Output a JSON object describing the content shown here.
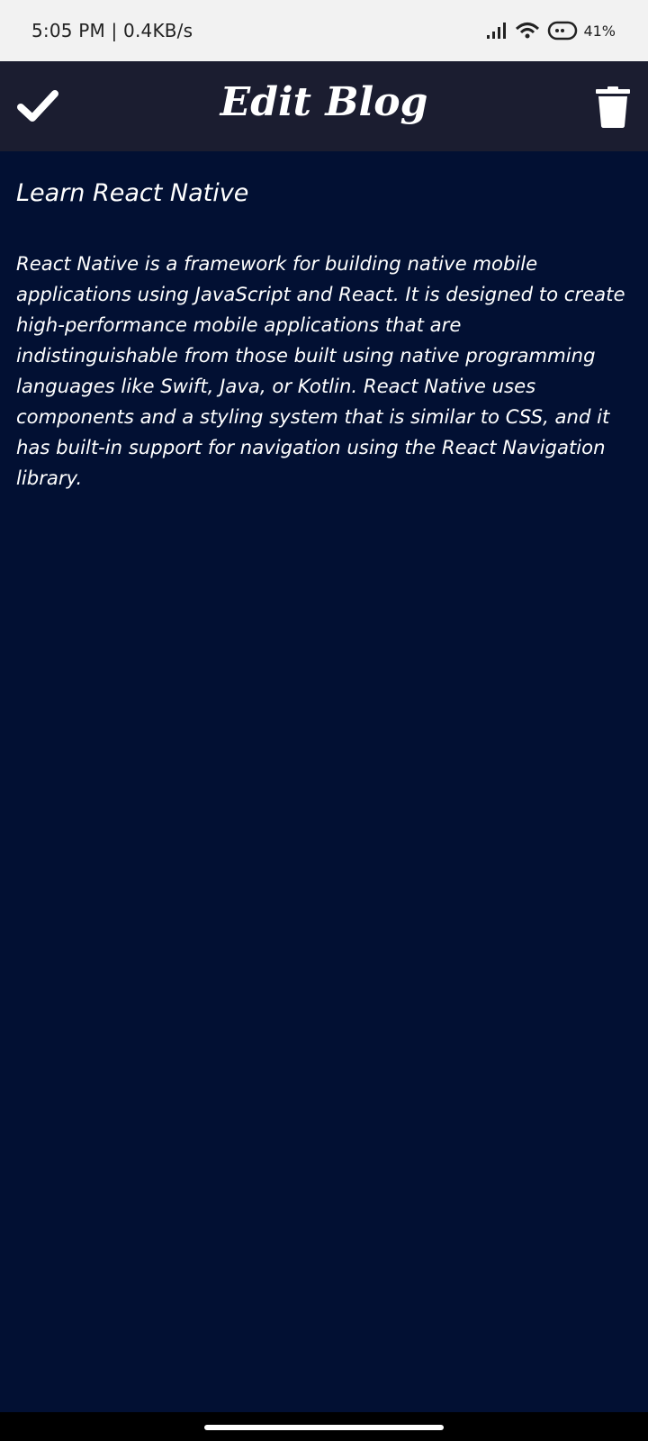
{
  "status_bar": {
    "time": "5:05 PM | 0.4KB/s",
    "battery": "41%",
    "icons": [
      "signal-icon",
      "wifi-icon",
      "battery-icon"
    ]
  },
  "header": {
    "title": "Edit Blog",
    "save_icon": "checkmark-icon",
    "delete_icon": "trash-icon"
  },
  "blog": {
    "title": "Learn React Native",
    "body": "React Native is a framework for building native mobile applications using JavaScript and React. It is designed to create high-performance mobile applications that are indistinguishable from those built using native programming languages like Swift, Java, or Kotlin. React Native uses components and a styling system that is similar to CSS, and it has built-in support for navigation using the React Navigation library."
  },
  "colors": {
    "background": "#021033",
    "header": "#1b1d30",
    "status_bar": "#f2f2f2",
    "text": "#ffffff"
  }
}
